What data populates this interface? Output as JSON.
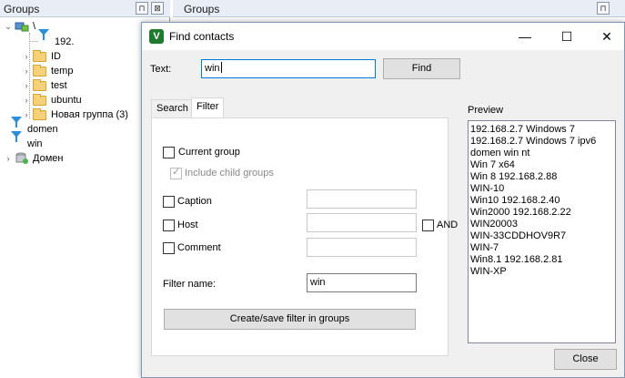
{
  "groups_panel": {
    "title": "Groups",
    "pin_glyph": "⊓",
    "close_glyph": "⊠",
    "tree": [
      {
        "label": "\\",
        "icon": "network-root-icon",
        "level": 0,
        "expanded": true
      },
      {
        "label": "192.",
        "icon": "filter-icon",
        "level": 1
      },
      {
        "label": "ID",
        "icon": "folder-icon",
        "level": 1
      },
      {
        "label": "temp",
        "icon": "folder-icon",
        "level": 1
      },
      {
        "label": "test",
        "icon": "folder-icon",
        "level": 1
      },
      {
        "label": "ubuntu",
        "icon": "folder-icon",
        "level": 1
      },
      {
        "label": "Новая группа (3)",
        "icon": "folder-icon",
        "level": 1
      },
      {
        "label": "domen",
        "icon": "filter-icon",
        "level": 0
      },
      {
        "label": "win",
        "icon": "filter-icon",
        "level": 0
      },
      {
        "label": "Домен",
        "icon": "domain-icon",
        "level": 0
      }
    ]
  },
  "right_panel": {
    "title": "Groups"
  },
  "dialog": {
    "title": "Find contacts",
    "app_icon": "V",
    "minimize_glyph": "—",
    "maximize_glyph": "☐",
    "close_glyph": "✕",
    "text_label": "Text:",
    "text_value": "win",
    "find_button": "Find",
    "tabs": [
      "Search",
      "Filter"
    ],
    "active_tab": "Filter",
    "filter": {
      "current_group": "Current group",
      "include_child_groups": "Include child groups",
      "caption": "Caption",
      "host": "Host",
      "and": "AND",
      "comment": "Comment",
      "filter_name_label": "Filter name:",
      "filter_name_value": "win",
      "create_save_button": "Create/save filter in groups"
    },
    "preview_label": "Preview",
    "preview_items": [
      "192.168.2.7 Windows 7",
      "192.168.2.7 Windows 7 ipv6",
      "domen win nt",
      "Win 7 x64",
      "Win 8 192.168.2.88",
      "WIN-10",
      "Win10 192.168.2.40",
      "Win2000 192.168.2.22",
      "WIN20003",
      "WIN-33CDDHOV9R7",
      "WIN-7",
      "Win8.1 192.168.2.81",
      "WIN-XP"
    ],
    "close_button": "Close"
  }
}
